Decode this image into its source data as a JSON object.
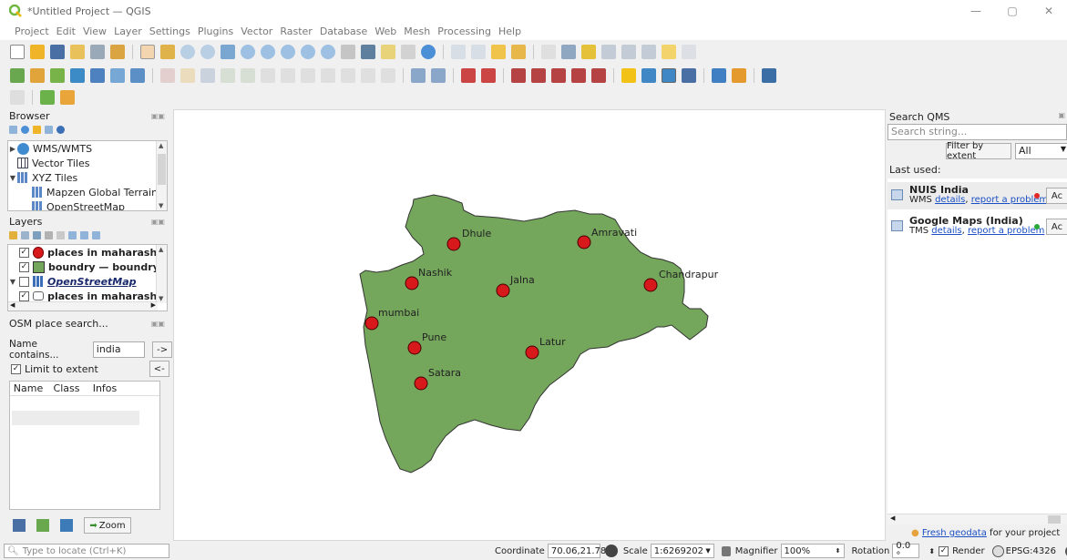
{
  "window": {
    "title": "*Untitled Project — QGIS",
    "minimize": "—",
    "maximize": "▢",
    "close": "✕"
  },
  "menubar": [
    "Project",
    "Edit",
    "View",
    "Layer",
    "Settings",
    "Plugins",
    "Vector",
    "Raster",
    "Database",
    "Web",
    "Mesh",
    "Processing",
    "Help"
  ],
  "browser": {
    "title": "Browser",
    "items": [
      {
        "label": "WMS/WMTS",
        "icon": "globe-icon",
        "expander": "▶"
      },
      {
        "label": "Vector Tiles",
        "icon": "grid-icon",
        "expander": ""
      },
      {
        "label": "XYZ Tiles",
        "icon": "tiles-icon",
        "expander": "▼"
      },
      {
        "label": "Mapzen Global Terrain",
        "icon": "tiles-icon",
        "expander": ""
      },
      {
        "label": "OpenStreetMap",
        "icon": "tiles-icon",
        "expander": ""
      }
    ]
  },
  "layers": {
    "title": "Layers",
    "items": [
      {
        "label": "places in maharashtr",
        "checked": true,
        "symbol": "red-circle",
        "bold": true
      },
      {
        "label": "boundry — boundry",
        "checked": true,
        "symbol": "green-square",
        "bold": true
      },
      {
        "label": "OpenStreetMap",
        "checked": false,
        "symbol": "osm-tiles",
        "bold": true,
        "italic": true
      },
      {
        "label": "places in maharashtr",
        "checked": true,
        "symbol": "polygon-outline",
        "bold": true
      }
    ]
  },
  "osm_search": {
    "title": "OSM place search...",
    "name_label": "Name contains...",
    "name_value": "india",
    "go_button": "->",
    "limit_label": "Limit to extent",
    "limit_checked": true,
    "back_button": "<-",
    "columns": [
      "Name",
      "Class",
      "Infos"
    ],
    "zoom_button": "Zoom"
  },
  "map": {
    "background": "#ffffff",
    "fill": "#74a65b",
    "point_color": "#d7191c",
    "places": [
      {
        "name": "Dhule"
      },
      {
        "name": "Amravati"
      },
      {
        "name": "Nashik"
      },
      {
        "name": "Jalna"
      },
      {
        "name": "Chandrapur"
      },
      {
        "name": "mumbai"
      },
      {
        "name": "Pune"
      },
      {
        "name": "Latur"
      },
      {
        "name": "Satara"
      }
    ]
  },
  "qms": {
    "title": "Search QMS",
    "search_placeholder": "Search string...",
    "filter_button": "Filter by extent",
    "filter_select": "All",
    "last_used": "Last used:",
    "services": [
      {
        "name": "NUIS India",
        "type": "WMS",
        "details": "details",
        "report": "report a problem",
        "status_color": "#e32626",
        "action": "Ac"
      },
      {
        "name": "Google Maps (India)",
        "type": "TMS",
        "details": "details",
        "report": "report a problem",
        "status_color": "#2aa838",
        "action": "Ac"
      }
    ],
    "footer_link": "Fresh geodata",
    "footer_text": "for your project"
  },
  "status": {
    "locator_placeholder": "Type to locate (Ctrl+K)",
    "coordinate_label": "Coordinate",
    "coordinate_value": "70.06,21.78",
    "scale_label": "Scale",
    "scale_value": "1:6269202",
    "magnifier_label": "Magnifier",
    "magnifier_value": "100%",
    "rotation_label": "Rotation",
    "rotation_value": "0.0 °",
    "render_label": "Render",
    "crs": "EPSG:4326"
  },
  "colors": {
    "accent": "#1a4fc4",
    "toolbar_bg": "#f0f0f0"
  }
}
